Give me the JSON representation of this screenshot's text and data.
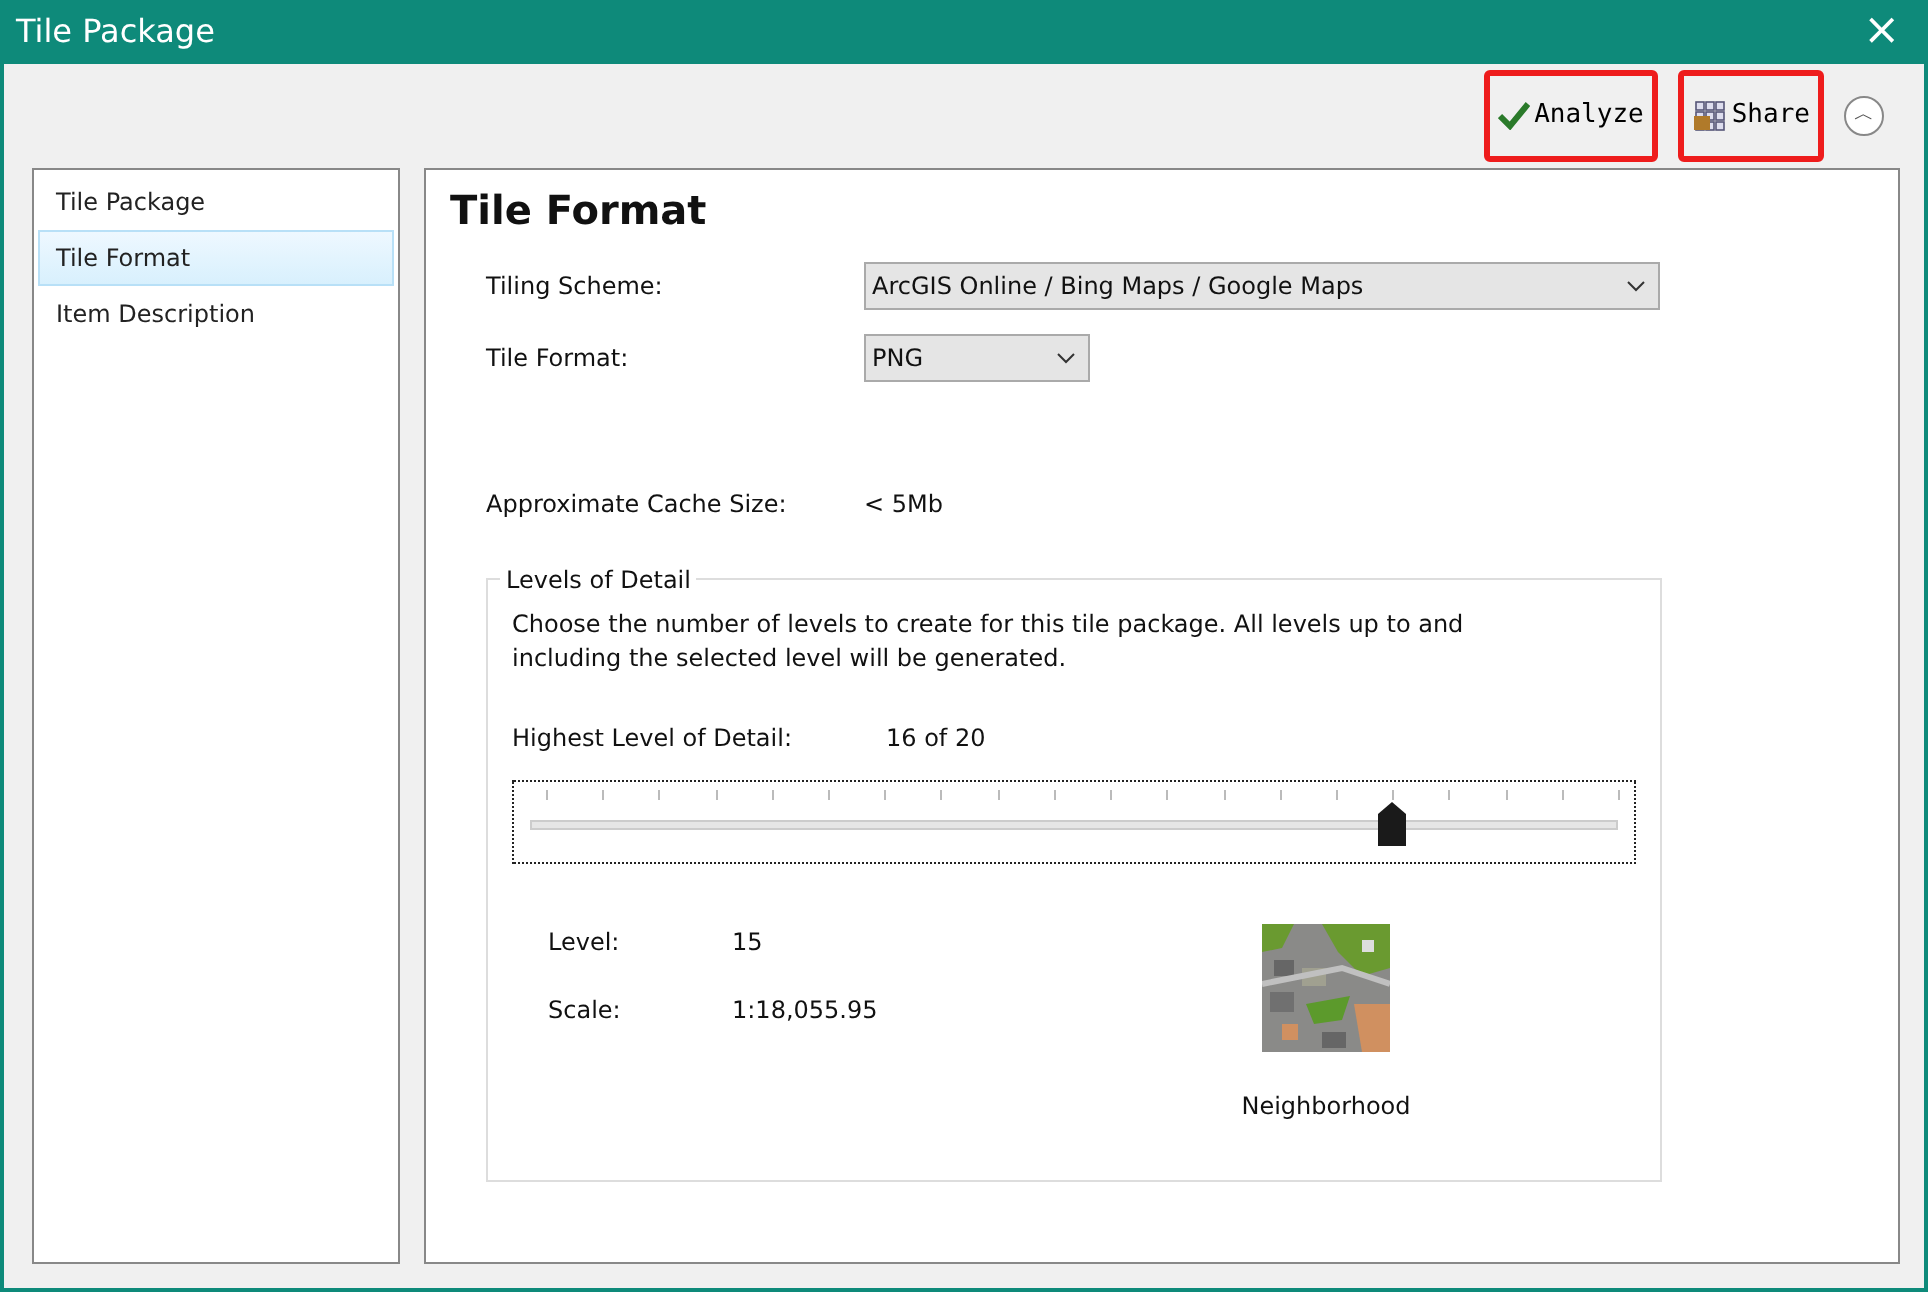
{
  "window": {
    "title": "Tile Package",
    "close": "×"
  },
  "toolbar": [
    {
      "kind": "analyze",
      "label": "Analyze",
      "highlighted": true
    },
    {
      "kind": "share",
      "label": "Share",
      "highlighted": true
    },
    {
      "kind": "collapse",
      "label": "︿"
    }
  ],
  "sidebar": {
    "items": [
      {
        "label": "Tile Package",
        "selected": false
      },
      {
        "label": "Tile Format",
        "selected": true
      },
      {
        "label": "Item Description",
        "selected": false
      }
    ]
  },
  "content": {
    "heading": "Tile Format",
    "fields": [
      {
        "label": "Tiling Scheme:",
        "value": "ArcGIS Online / Bing Maps / Google Maps",
        "kind": "wide"
      },
      {
        "label": "Tile Format:",
        "value": "PNG",
        "kind": "narrow"
      }
    ],
    "cache_size": {
      "label": "Approximate Cache Size:",
      "value": "< 5Mb"
    },
    "levels_of_detail": {
      "legend": "Levels of Detail",
      "description": "Choose the number of levels to create for this tile package.   All levels up to and including the selected level will be generated.",
      "highest_label": "Highest Level of Detail:",
      "highest_value": "16 of 20",
      "slider": {
        "level": 0.79
      },
      "level_label": "Level:",
      "level_value": "15",
      "scale_label": "Scale:",
      "scale_value": "1:18,055.95",
      "preview": {
        "kind": "picture",
        "caption": "Neighborhood"
      }
    }
  }
}
